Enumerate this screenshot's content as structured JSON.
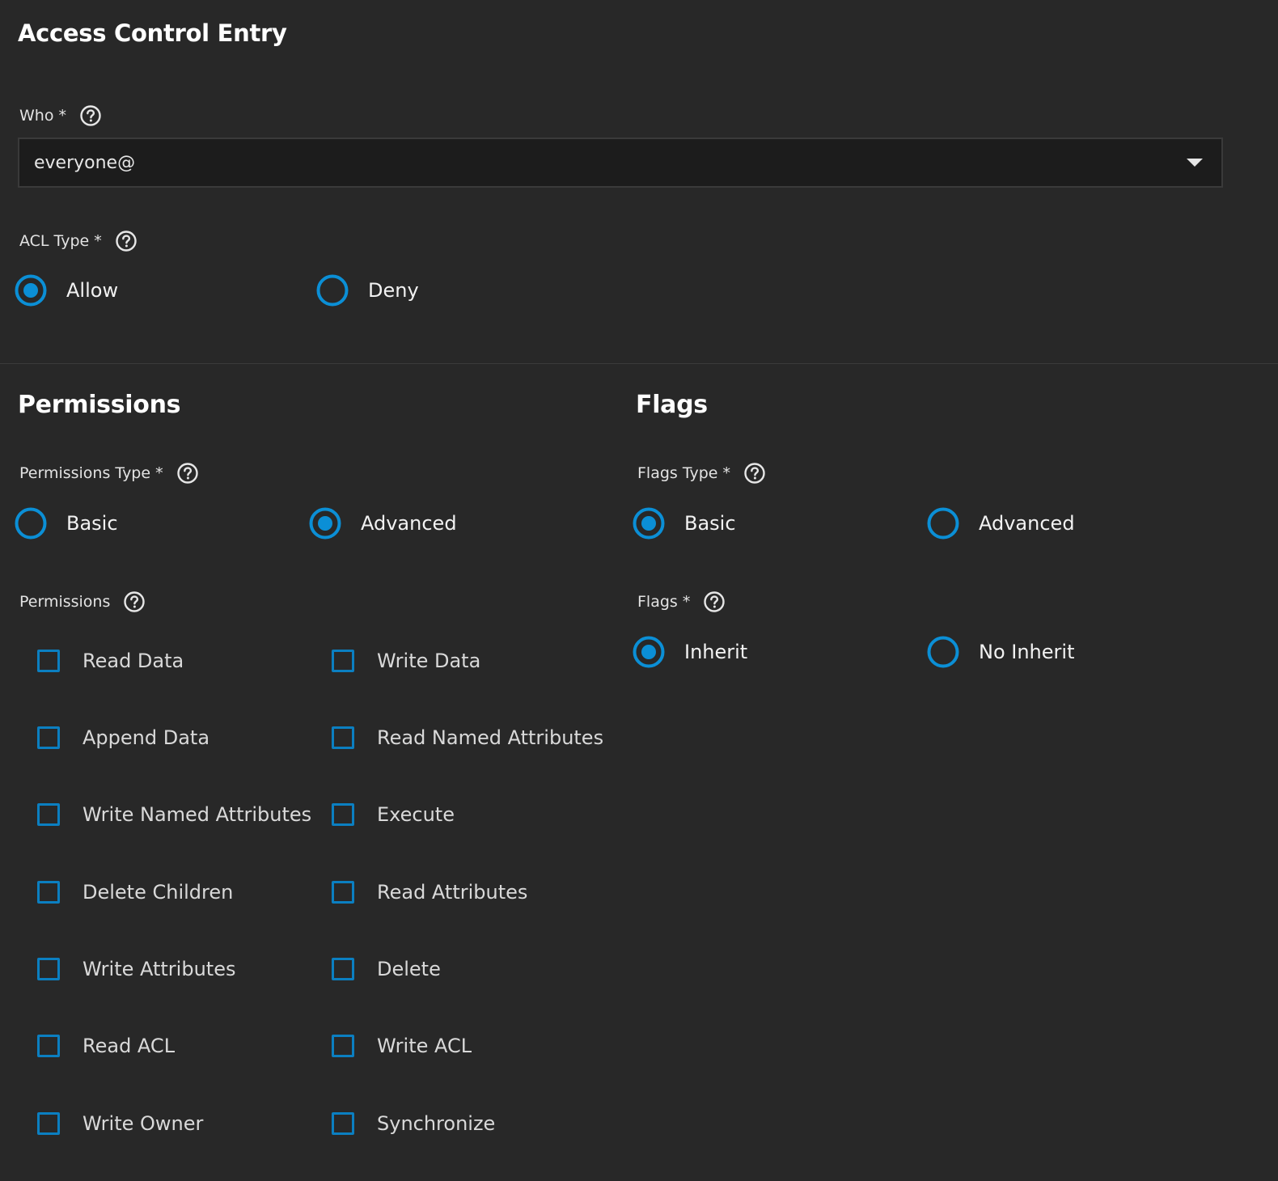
{
  "header": {
    "title": "Access Control Entry"
  },
  "who": {
    "label": "Who *",
    "value": "everyone@"
  },
  "acl_type": {
    "label": "ACL Type *",
    "options": [
      {
        "label": "Allow",
        "selected": true
      },
      {
        "label": "Deny",
        "selected": false
      }
    ]
  },
  "permissions": {
    "section_title": "Permissions",
    "type_label": "Permissions Type *",
    "type_options": [
      {
        "label": "Basic",
        "selected": false
      },
      {
        "label": "Advanced",
        "selected": true
      }
    ],
    "list_label": "Permissions",
    "items": [
      {
        "label": "Read Data",
        "checked": false
      },
      {
        "label": "Write Data",
        "checked": false
      },
      {
        "label": "Append Data",
        "checked": false
      },
      {
        "label": "Read Named Attributes",
        "checked": false
      },
      {
        "label": "Write Named Attributes",
        "checked": false
      },
      {
        "label": "Execute",
        "checked": false
      },
      {
        "label": "Delete Children",
        "checked": false
      },
      {
        "label": "Read Attributes",
        "checked": false
      },
      {
        "label": "Write Attributes",
        "checked": false
      },
      {
        "label": "Delete",
        "checked": false
      },
      {
        "label": "Read ACL",
        "checked": false
      },
      {
        "label": "Write ACL",
        "checked": false
      },
      {
        "label": "Write Owner",
        "checked": false
      },
      {
        "label": "Synchronize",
        "checked": false
      }
    ]
  },
  "flags": {
    "section_title": "Flags",
    "type_label": "Flags Type *",
    "type_options": [
      {
        "label": "Basic",
        "selected": true
      },
      {
        "label": "Advanced",
        "selected": false
      }
    ],
    "flags_label": "Flags *",
    "flag_options": [
      {
        "label": "Inherit",
        "selected": true
      },
      {
        "label": "No Inherit",
        "selected": false
      }
    ]
  },
  "colors": {
    "background": "#282828",
    "accent": "#0b8fd6",
    "field_background": "#1c1c1c"
  },
  "icons": {
    "help": "help-circle-icon",
    "dropdown": "caret-down-icon"
  }
}
